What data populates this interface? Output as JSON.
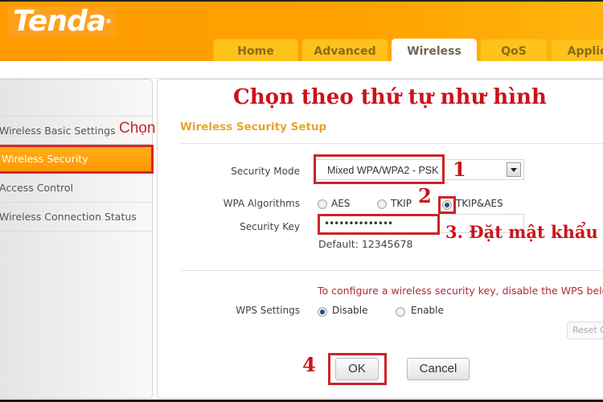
{
  "brand": {
    "logo_text": "Tenda",
    "registered_mark": "®"
  },
  "nav": {
    "tabs": [
      {
        "label": "Home",
        "active": false
      },
      {
        "label": "Advanced",
        "active": false
      },
      {
        "label": "Wireless",
        "active": true
      },
      {
        "label": "QoS",
        "active": false
      },
      {
        "label": "Applic",
        "active": false
      }
    ]
  },
  "sidebar": {
    "items": [
      {
        "label": "Wireless Basic Settings",
        "active": false
      },
      {
        "label": "Wireless Security",
        "active": true
      },
      {
        "label": "Access Control",
        "active": false
      },
      {
        "label": "Wireless Connection Status",
        "active": false
      }
    ]
  },
  "annotations": {
    "title": "Chọn theo thứ tự như hình",
    "side_chon": "Chọn",
    "step1": "1",
    "step2": "2",
    "step3": "3. Đặt mật khẩu",
    "step4": "4",
    "highlight_color": "#c9252b"
  },
  "form": {
    "section_title": "Wireless Security Setup",
    "security_mode": {
      "label": "Security Mode",
      "value": "Mixed WPA/WPA2 - PSK"
    },
    "wpa_algorithms": {
      "label": "WPA Algorithms",
      "options": [
        {
          "label": "AES",
          "selected": false
        },
        {
          "label": "TKIP",
          "selected": false
        },
        {
          "label": "TKIP&AES",
          "selected": true
        }
      ]
    },
    "security_key": {
      "label": "Security Key",
      "value": "••••••••••••••",
      "default_text": "Default: 12345678"
    },
    "wps": {
      "note": "To configure a wireless security key, disable the WPS below",
      "label": "WPS Settings",
      "options": [
        {
          "label": "Disable",
          "selected": true
        },
        {
          "label": "Enable",
          "selected": false
        }
      ],
      "reset_label": "Reset OOB"
    },
    "ok_label": "OK",
    "cancel_label": "Cancel"
  },
  "colors": {
    "brand_orange": "#ffa200",
    "tab_yellow": "#ffc21b",
    "section_title": "#e9a52b",
    "note_red": "#b12a3a"
  }
}
